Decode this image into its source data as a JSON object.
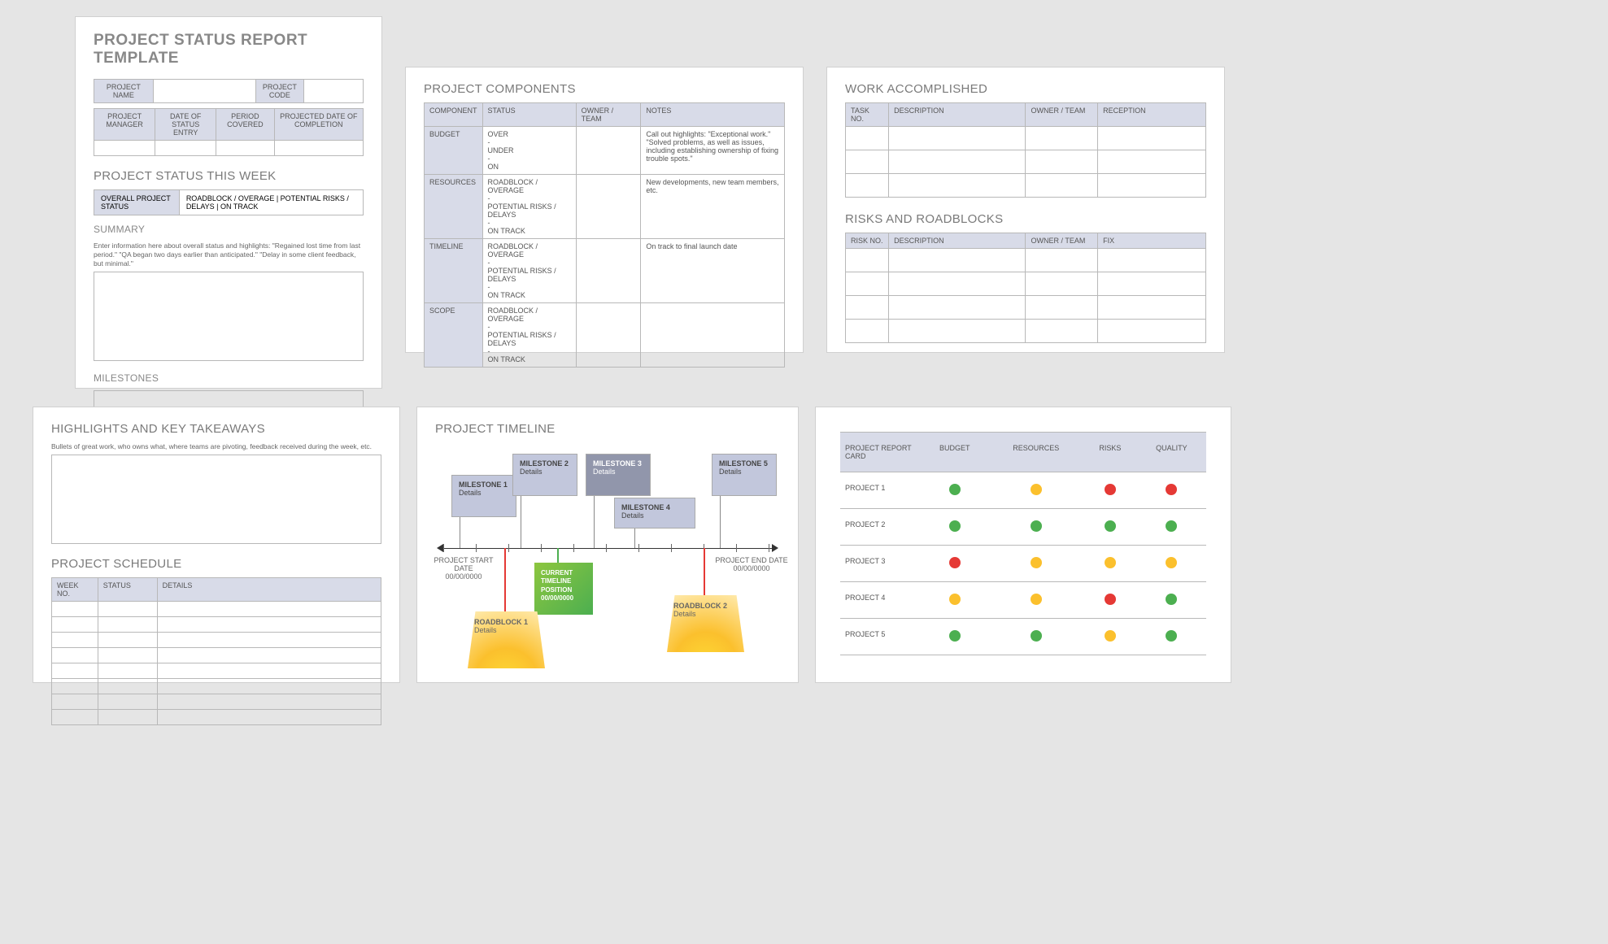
{
  "page1": {
    "title": "PROJECT STATUS REPORT TEMPLATE",
    "row1": {
      "name": "PROJECT NAME",
      "code": "PROJECT CODE"
    },
    "row2": {
      "mgr": "PROJECT MANAGER",
      "entry": "DATE OF STATUS ENTRY",
      "period": "PERIOD COVERED",
      "proj": "PROJECTED DATE OF COMPLETION"
    },
    "weekTitle": "PROJECT STATUS THIS WEEK",
    "statusLabel": "OVERALL PROJECT STATUS",
    "statusOpts": "ROADBLOCK / OVERAGE    |    POTENTIAL RISKS / DELAYS    |    ON TRACK",
    "summaryTitle": "SUMMARY",
    "summaryHint": "Enter information here about overall status and highlights: \"Regained lost time from last period.\" \"QA began two days earlier than anticipated.\" \"Delay in some client feedback, but minimal.\"",
    "milestonesTitle": "MILESTONES"
  },
  "page2": {
    "title": "PROJECT COMPONENTS",
    "headers": [
      "COMPONENT",
      "STATUS",
      "OWNER / TEAM",
      "NOTES"
    ],
    "rows": [
      {
        "comp": "BUDGET",
        "status": "OVER\n-\nUNDER\n-\nON",
        "notes": "Call out highlights: \"Exceptional work.\" \"Solved problems, as well as issues, including establishing ownership of fixing trouble spots.\""
      },
      {
        "comp": "RESOURCES",
        "status": "ROADBLOCK / OVERAGE\n-\nPOTENTIAL RISKS / DELAYS\n-\nON TRACK",
        "notes": "New developments, new team members, etc."
      },
      {
        "comp": "TIMELINE",
        "status": "ROADBLOCK / OVERAGE\n-\nPOTENTIAL RISKS / DELAYS\n-\nON TRACK",
        "notes": "On track to final launch date"
      },
      {
        "comp": "SCOPE",
        "status": "ROADBLOCK / OVERAGE\n-\nPOTENTIAL RISKS / DELAYS\n-\nON TRACK",
        "notes": ""
      }
    ]
  },
  "page3": {
    "waTitle": "WORK ACCOMPLISHED",
    "waHeaders": [
      "TASK NO.",
      "DESCRIPTION",
      "OWNER / TEAM",
      "RECEPTION"
    ],
    "rrTitle": "RISKS AND ROADBLOCKS",
    "rrHeaders": [
      "RISK NO.",
      "DESCRIPTION",
      "OWNER / TEAM",
      "FIX"
    ]
  },
  "page4": {
    "hkTitle": "HIGHLIGHTS AND KEY TAKEAWAYS",
    "hkHint": "Bullets of great work, who owns what, where teams are pivoting, feedback received during the week, etc.",
    "psTitle": "PROJECT SCHEDULE",
    "psHeaders": [
      "WEEK NO.",
      "STATUS",
      "DETAILS"
    ]
  },
  "page5": {
    "title": "PROJECT TIMELINE",
    "start": {
      "l1": "PROJECT START DATE",
      "l2": "00/00/0000"
    },
    "end": {
      "l1": "PROJECT END DATE",
      "l2": "00/00/0000"
    },
    "m1": {
      "t": "MILESTONE 1",
      "d": "Details"
    },
    "m2": {
      "t": "MILESTONE 2",
      "d": "Details"
    },
    "m3": {
      "t": "MILESTONE 3",
      "d": "Details"
    },
    "m4": {
      "t": "MILESTONE 4",
      "d": "Details"
    },
    "m5": {
      "t": "MILESTONE 5",
      "d": "Details"
    },
    "current": "CURRENT TIMELINE POSITION 00/00/0000",
    "rb1": {
      "t": "ROADBLOCK 1",
      "d": "Details"
    },
    "rb2": {
      "t": "ROADBLOCK 2",
      "d": "Details"
    }
  },
  "page6": {
    "headers": [
      "PROJECT REPORT CARD",
      "BUDGET",
      "RESOURCES",
      "RISKS",
      "QUALITY"
    ],
    "rows": [
      {
        "name": "PROJECT 1",
        "c": [
          "g",
          "y",
          "r",
          "r"
        ]
      },
      {
        "name": "PROJECT 2",
        "c": [
          "g",
          "g",
          "g",
          "g"
        ]
      },
      {
        "name": "PROJECT 3",
        "c": [
          "r",
          "y",
          "y",
          "y"
        ]
      },
      {
        "name": "PROJECT 4",
        "c": [
          "y",
          "y",
          "r",
          "g"
        ]
      },
      {
        "name": "PROJECT 5",
        "c": [
          "g",
          "g",
          "y",
          "g"
        ]
      }
    ]
  }
}
